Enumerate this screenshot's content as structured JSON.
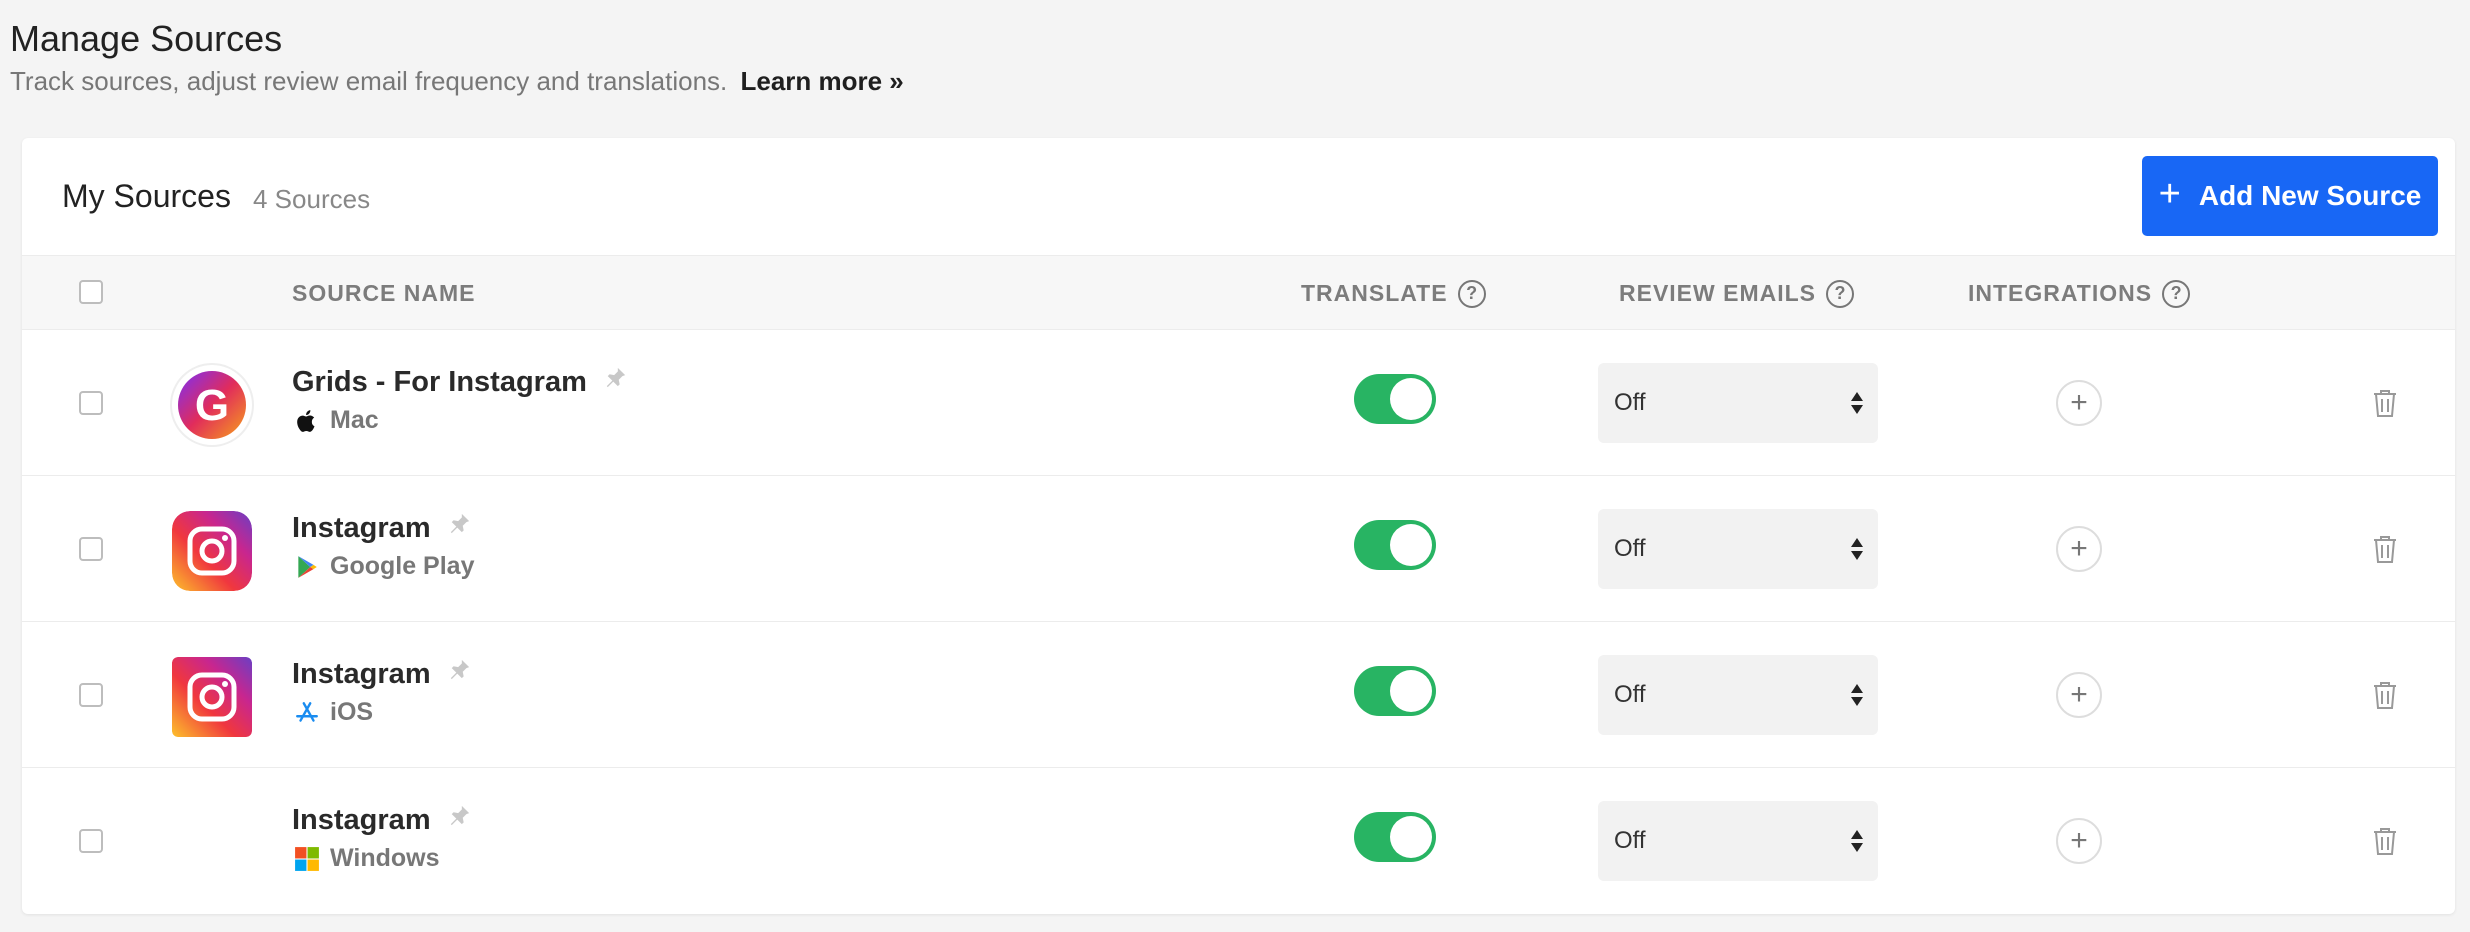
{
  "header": {
    "title": "Manage Sources",
    "subtitle": "Track sources, adjust review email frequency and translations.",
    "learn_more": "Learn more »"
  },
  "card": {
    "title": "My Sources",
    "count": "4 Sources",
    "add_button": "Add New Source"
  },
  "table": {
    "columns": {
      "source_name": "SOURCE NAME",
      "translate": "TRANSLATE",
      "review_emails": "REVIEW EMAILS",
      "integrations": "INTEGRATIONS"
    },
    "rows": [
      {
        "name": "Grids - For Instagram",
        "platform": "Mac",
        "platform_icon": "apple-icon",
        "app_icon": "grids-icon",
        "translate": true,
        "review_emails": "Off"
      },
      {
        "name": "Instagram",
        "platform": "Google Play",
        "platform_icon": "google-play-icon",
        "app_icon": "instagram-icon",
        "translate": true,
        "review_emails": "Off"
      },
      {
        "name": "Instagram",
        "platform": "iOS",
        "platform_icon": "app-store-icon",
        "app_icon": "instagram-icon",
        "translate": true,
        "review_emails": "Off"
      },
      {
        "name": "Instagram",
        "platform": "Windows",
        "platform_icon": "windows-icon",
        "app_icon": "",
        "translate": true,
        "review_emails": "Off"
      }
    ]
  },
  "colors": {
    "accent": "#1867f5",
    "toggle_on": "#28b463"
  }
}
